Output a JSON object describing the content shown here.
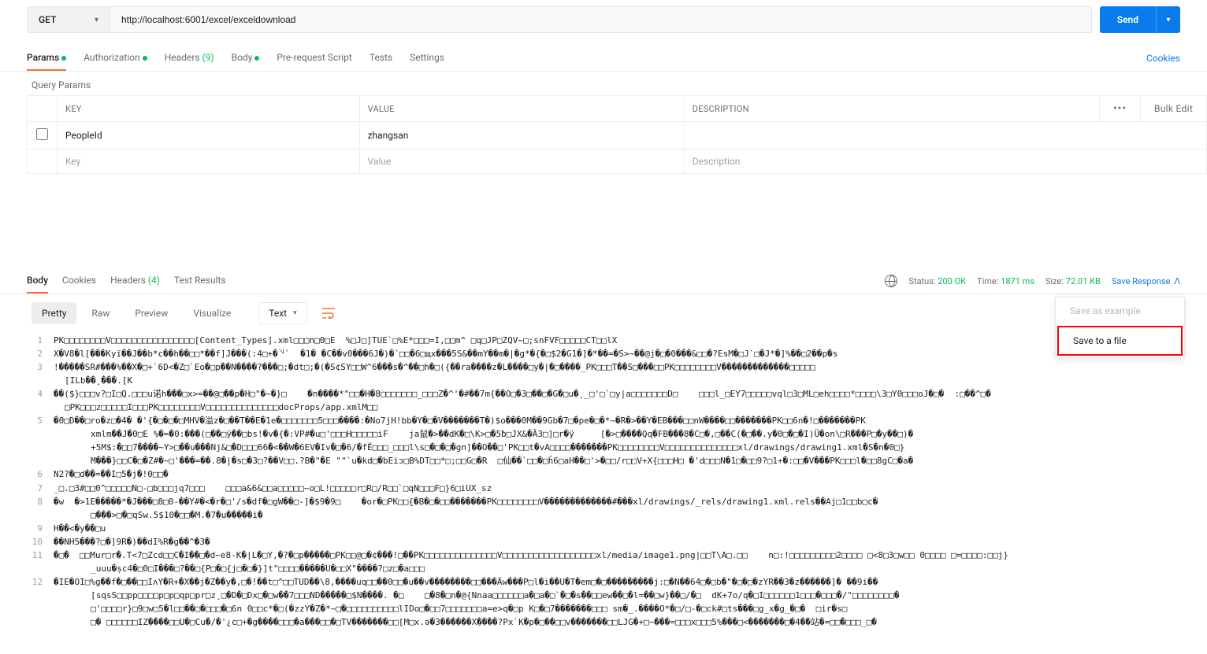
{
  "request": {
    "method": "GET",
    "url": "http://localhost:6001/excel/exceldownload",
    "send_label": "Send"
  },
  "tabs": {
    "params": "Params",
    "authorization": "Authorization",
    "headers": "Headers",
    "headers_count": "(9)",
    "body": "Body",
    "prerequest": "Pre-request Script",
    "tests": "Tests",
    "settings": "Settings",
    "cookies_link": "Cookies"
  },
  "query_params": {
    "label": "Query Params",
    "columns": {
      "key": "KEY",
      "value": "VALUE",
      "description": "DESCRIPTION",
      "bulk": "Bulk Edit"
    },
    "rows": [
      {
        "key": "PeopleId",
        "value": "zhangsan",
        "desc": ""
      }
    ],
    "placeholders": {
      "key": "Key",
      "value": "Value",
      "desc": "Description"
    }
  },
  "response_tabs": {
    "body": "Body",
    "cookies": "Cookies",
    "headers": "Headers",
    "headers_count": "(4)",
    "test_results": "Test Results"
  },
  "status": {
    "status_label": "Status:",
    "status_value": "200 OK",
    "time_label": "Time:",
    "time_value": "1871 ms",
    "size_label": "Size:",
    "size_value": "72.01 KB",
    "save_response": "Save Response",
    "menu": {
      "save_example": "Save as example",
      "save_file": "Save to a file"
    }
  },
  "view": {
    "pretty": "Pretty",
    "raw": "Raw",
    "preview": "Preview",
    "visualize": "Visualize",
    "format": "Text"
  },
  "body_lines": [
    "PK□□□□□□□□V□□□□□□□□□□□□□□□□[Content_Types].xml□□□n□0□E  %□J□]TUE`□%E*□□□=I,□□m^ □q□JP□ZQV~□;snFVF□□□□□CT□□lX",
    "X�V8�l[���Kyï��J��b*c��h��□□*��f]J���(:4□+�꒣`  �1� �C��v0���6J�)�`□□�6□щx���5S&��mY��m�|�g*�{�□$2�G1�]�*��=�S>~��@j�□�0���&□□�?EsM�□J`□�J*�]%��□2��p�s",
    "!�����SR#���%��X�□+`6D<�Z□`Eo�□p��N����?���□;�dt□;�(�S¢SY□□W^6���s�^��□h�□({��ra����z�L����□y�|�□����_PK□□□T��S□���□□PK□□□□□□□□V�������������□□□□□",
    "�0□D��□ro�z□�4� �'{�□�□�□MHV�溢z�□��T��E�1e�□□□□□□□5□□□����:�No7jH!bb�Y�□�V�������T�)$o���0M��9Gb�7□�pe�□�*~�R�>��Y�EB���□□nW����□□�������PK□□6n�!□�������PK",
    "N2?�□d��=��I□5�j�!0□□�",
    "_□.□3#□□0^□□□□□N□-□b□□□jq7□□□    □□□a&6&□□a□□□□□~o□L!□□□□□r□R□/R□□`□qN□□□F□}6□iUX_sz",
    "�w  �>1E�����*�J���□8□0-��Y#�<�r�□'/s�df�□gW��□-]�$9�9□    �or�□PK□□{�B�□�□□�������PK□□□□□□□□V�������������#���xl/drawings/_rels/drawing1.xml.rels��Aj□1□□b□c�",
    "H��<�y��□u",
    "��NH5���?□�]9R�)��dI%R�g��^�3�",
    "�□�  □□Mur□r�.T<7□Zcd□□C�I��□�d~e8-K�|L�□Y‚�?�□p�����□PK□□@□�¢���!□��PK□□□□□□□□□□□□□□V□□□□□□□□□□□□□□□□□□xl/media/image1.png|□□T\\A□.□□    n□:!□□□□□□□□□2□□□□ □<8□3□w□□ 0□□□□ □=□□□□:□□j}",
    "�IE�OI□%g��f�□��□□IʌY�R+�X��j�Z��y�‚□�!��t□^□□TUD��\\8,����uq□□��0□□�u��v��������□□���Äw���P□l�i��U�T�em□�□���������j:□�N��64□�□b�\"�□�□�zYR��3�z������]� ��9i��"
  ],
  "line_numbers": [
    "1",
    "2",
    "3",
    "4",
    "5",
    "6",
    "7",
    "8",
    "9",
    "10",
    "11",
    "12"
  ],
  "body_cont": {
    "l3": "[ILb��¸���.[K",
    "l4a": "��($}□□□v?□I□Q.□□□u诺h���□x>=��@□��p�H□\"�~�}□    �n����*\"□□�H�8□□□□□□□_□□□Z�^'�#��7m{��O□�3□��□�G�□u�¸_□'□`□y|a□□□□□□□D□    □□□l_□EY7□□□□□vql□3□ML□eh□□□□*□□□□\\3□Y0□□□oJ�□�  :□��^□�",
    "l4b": "□PK□□□z□□□□□I□□□PK□□□□□□□□V□□□□□□□□□□□□□□docProps/app.xmlM□□",
    "l5a": "     xmlm��J�0□E %�=�0:���(□��□ÿ��□bs!�v�{�:VP#�u□'□□□H□□□□□iF    ja鼠�>��dK�□\\K>□�5ƀ□JX&�Ã3□]□r�ÿ     [�>□����Qq�FB���8�C□�,□��C(�□��.y�0□�□�I)Ü�on\\□R���P□�y��□)�",
    "l5b": "     +5M$:�□□7����~Y>□��u���Nj&□�D□□□66�<��W�6EV�Iv�□�6/�fË□□□_□□□l\\s□�□�□�gn]��O��□'PK□□t�vA□□□□�������PK□□□□□□□□V□□□□□□□□□□□□□□xl/drawings/drawing1.xml�S�n�0□}",
    "l5c": "     M���}□□C�□�Z#�~□'���=��.8�|�s□�3□?��V□□.?B�\"�E \"\"`u�kd□�bEiɔ□B%DT□□*□;□□G□�R  □仙��`□□�□ȟ6□aH��□'>�□□/r□□V+X{□□□H□ �'d□□□N�1□�□□9?□1+�:□□�V���PK□□□l�□□8gC□�a�",
    "l8": "     □���>□�□qSw.5$10�□□�M.�7�u�����i�",
    "l11": "     _uuu�ṣc4�□0□I���□?��□{P□�□{j□�□�}]t\"□□□□�����U�□□X\"����?□z□�a□□□",
    "l12a": "     [sqsS□□pp□□□□p□p□qp□pr□z¸□�D�□Dx□�□w��7□□□ND�����□$N����. �□    □�8�□n�@{Nnaa□□□□□□a�□a�□`�□�s��□□ew��□�l=��□w}��□/�□  dK+7o/q�□I□□□□□□1□□□�□□□�/\"□□□□□□□□�",
    "l12b": "     □'□□□□r}□9□w□5�l□□��□�□□□�□6n 0□□c*�□(�zzY�Z�*~□�□□□□□□□□□□lIDo□�□□7□□□□□□□a=e>q�□p K□�□7�������□□□ sm�_.����O*�□/□-�□ck#□ts���□g_x�g_�□�  □ir�s□",
    "l12c": "     □� □□□□□□IZ����□□U�□Cu�/�'¿c□+�g����□□□�a���□□�□TV�������□□[M□x.ǝ�3������X����?Px`K�p�□��□□v�������□□LJG�+□~���=□□□x□□□5%���□<�������□�4��站�=□□�□□□_□�"
  }
}
